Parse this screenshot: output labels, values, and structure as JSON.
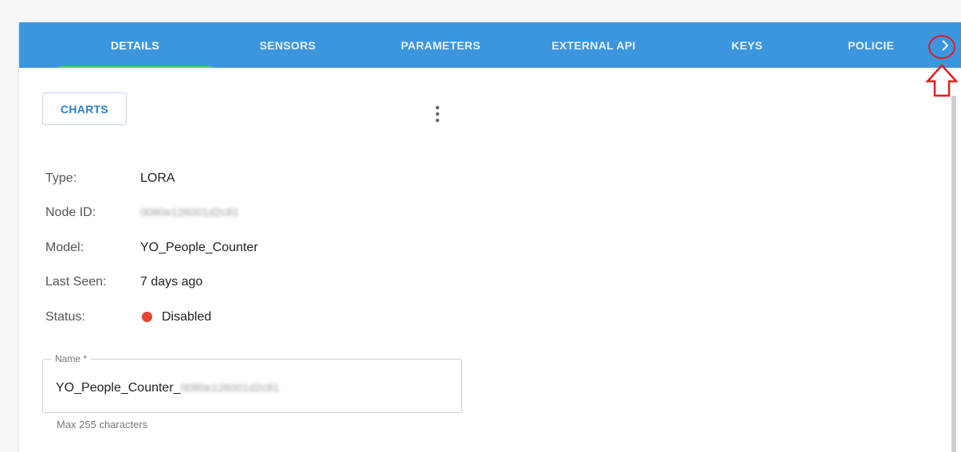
{
  "tabs": [
    {
      "label": "DETAILS",
      "active": true
    },
    {
      "label": "SENSORS",
      "active": false
    },
    {
      "label": "PARAMETERS",
      "active": false
    },
    {
      "label": "EXTERNAL API",
      "active": false
    },
    {
      "label": "KEYS",
      "active": false
    },
    {
      "label": "POLICIE",
      "active": false
    }
  ],
  "tab_scroll_icon": "chevron-right-icon",
  "toolbar": {
    "charts_label": "CHARTS",
    "menu_icon": "more-vert-icon"
  },
  "details": {
    "type": {
      "label": "Type:",
      "value": "LORA"
    },
    "node_id": {
      "label": "Node ID:",
      "value": "0080e126001d2c81"
    },
    "model": {
      "label": "Model:",
      "value": "YO_People_Counter"
    },
    "last_seen": {
      "label": "Last Seen:",
      "value": "7 days ago"
    },
    "status": {
      "label": "Status:",
      "value": "Disabled",
      "color": "#e9412e"
    }
  },
  "name_field": {
    "legend": "Name *",
    "value_prefix": "YO_People_Counter_",
    "value_suffix": "0080e126001d2c81",
    "hint": "Max 255 characters"
  },
  "colors": {
    "tabbar": "#3b96df",
    "indicator": "#4ad06f",
    "annotation": "#e01e1e"
  }
}
